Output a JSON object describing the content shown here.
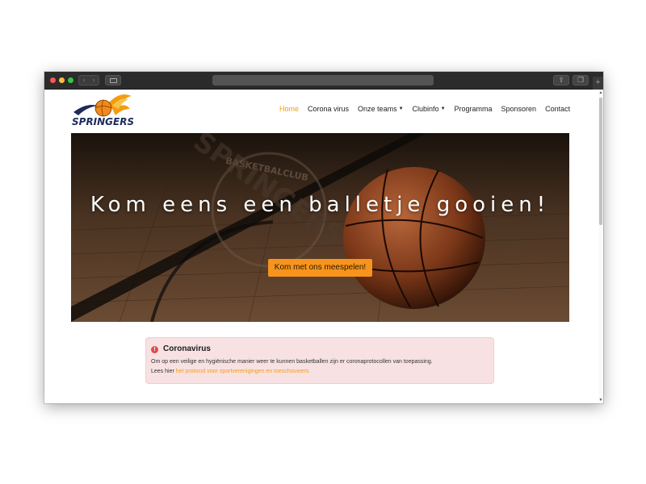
{
  "browser": {
    "share_icon": "share-icon",
    "tabs_icon": "tabs-icon",
    "new_tab_glyph": "+"
  },
  "site": {
    "logo_text": "SPRINGERS",
    "nav": [
      {
        "label": "Home",
        "active": true
      },
      {
        "label": "Corona virus"
      },
      {
        "label": "Onze teams",
        "dropdown": true
      },
      {
        "label": "Clubinfo",
        "dropdown": true
      },
      {
        "label": "Programma"
      },
      {
        "label": "Sponsoren"
      },
      {
        "label": "Contact"
      }
    ],
    "accent_color": "#f39c12"
  },
  "hero": {
    "title": "Kom eens een balletje gooien!",
    "cta_label": "Kom met ons meespelen!",
    "watermark_text": "BASKETBALCLUB",
    "watermark_text2": "SPRINGERS"
  },
  "alert": {
    "title": "Coronavirus",
    "body": "Om op een veilige en hygiënische manier weer te kunnen basketballen zijn er coronaprotocollen van toepassing.",
    "line2_prefix": "Lees hier",
    "link_text": "het protocol voor sportverenigingen en toeschouwers.",
    "icon": "exclamation-icon",
    "background": "#f8e1e3"
  }
}
